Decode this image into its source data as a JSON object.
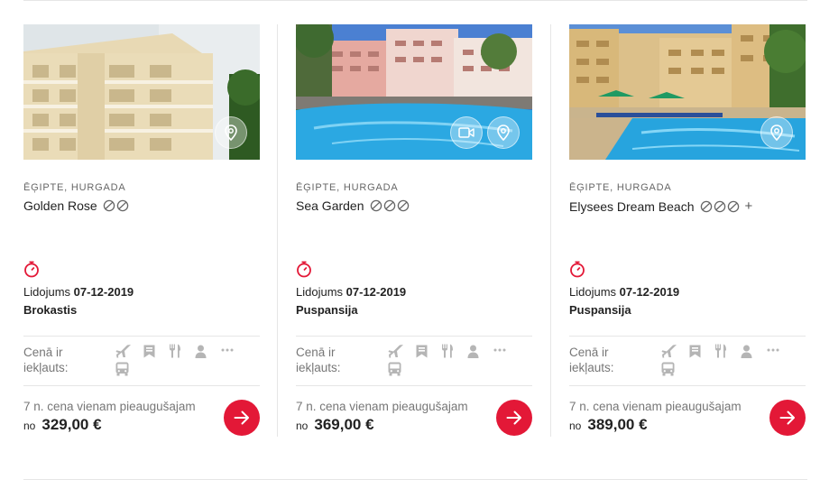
{
  "cards": [
    {
      "location": "Ēģipte, Hurgada",
      "hotel_name": "Golden Rose",
      "rating_icons": [
        "rating-ring-icon",
        "rating-ring-icon"
      ],
      "plus": "",
      "flight_label": "Lidojums",
      "flight_date": "07-12-2019",
      "board": "Brokastis",
      "included_label": "Cenā ir iekļauts:",
      "price_caption": "7 n. cena vienam pieaugušajam",
      "price_from": "no",
      "price": "329,00 €",
      "photo_buttons": [
        "map-pin-icon"
      ]
    },
    {
      "location": "Ēģipte, Hurgada",
      "hotel_name": "Sea Garden",
      "rating_icons": [
        "rating-ring-icon",
        "rating-ring-icon",
        "rating-ring-icon"
      ],
      "plus": "",
      "flight_label": "Lidojums",
      "flight_date": "07-12-2019",
      "board": "Puspansija",
      "included_label": "Cenā ir iekļauts:",
      "price_caption": "7 n. cena vienam pieaugušajam",
      "price_from": "no",
      "price": "369,00 €",
      "photo_buttons": [
        "video-icon",
        "map-pin-icon"
      ]
    },
    {
      "location": "Ēģipte, Hurgada",
      "hotel_name": "Elysees Dream Beach",
      "rating_icons": [
        "rating-ring-icon",
        "rating-ring-icon",
        "rating-ring-icon"
      ],
      "plus": "+",
      "flight_label": "Lidojums",
      "flight_date": "07-12-2019",
      "board": "Puspansija",
      "included_label": "Cenā ir iekļauts:",
      "price_caption": "7 n. cena vienam pieaugušajam",
      "price_from": "no",
      "price": "389,00 €",
      "photo_buttons": [
        "map-pin-icon"
      ]
    }
  ],
  "included_icons": [
    "airplane-icon",
    "hotel-icon",
    "fork-knife-icon",
    "person-icon",
    "more-icon",
    "bus-icon"
  ],
  "colors": {
    "accent": "#e31837",
    "text": "#222222",
    "muted": "#777777",
    "icon_gray": "#b5b5b5",
    "divider": "#e6e6e6"
  }
}
